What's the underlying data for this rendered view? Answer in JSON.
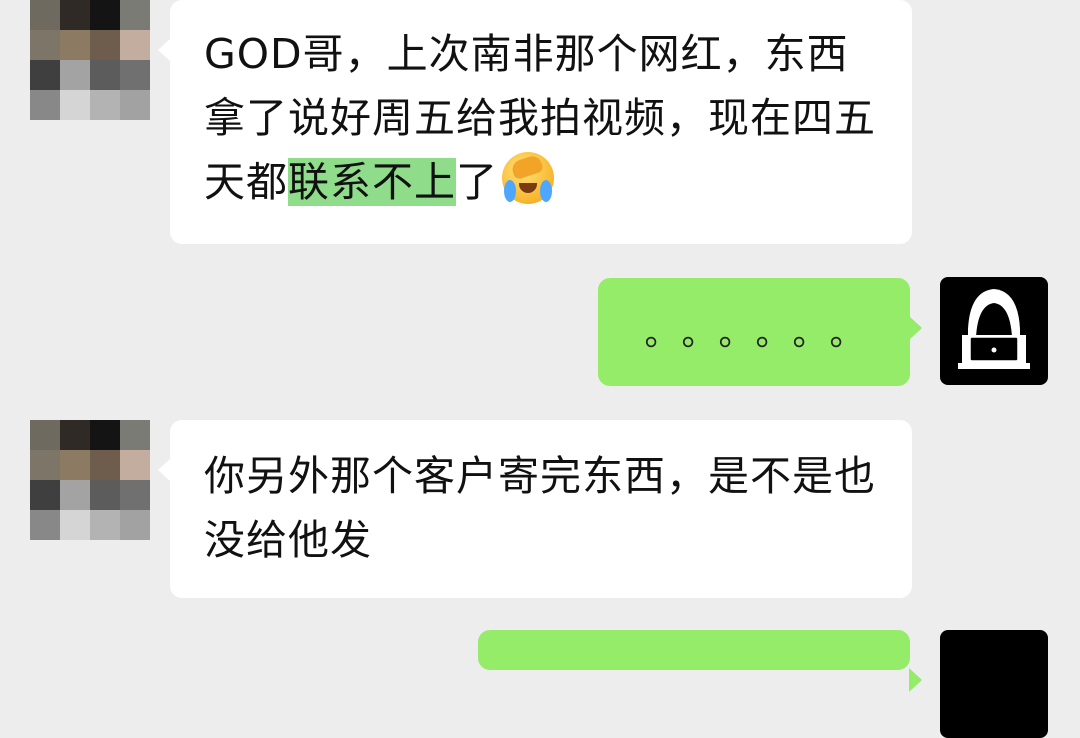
{
  "messages": [
    {
      "side": "left",
      "text_before": "GOD哥，上次南非那个网红，东西拿了说好周五给我拍视频，现在四五天都",
      "text_highlight": "联系不上",
      "text_after": "了",
      "emoji": "face-with-hand-crying-emoji"
    },
    {
      "side": "right",
      "text": "。。。。。。"
    },
    {
      "side": "left",
      "text": "你另外那个客户寄完东西，是不是也没给他发"
    }
  ],
  "avatars": {
    "contact": "pixelated-avatar",
    "self": "hooded-hacker-avatar"
  },
  "colors": {
    "background": "#ededed",
    "incoming_bubble": "#ffffff",
    "outgoing_bubble": "#95ec69",
    "highlight": "#8fdc8b"
  }
}
